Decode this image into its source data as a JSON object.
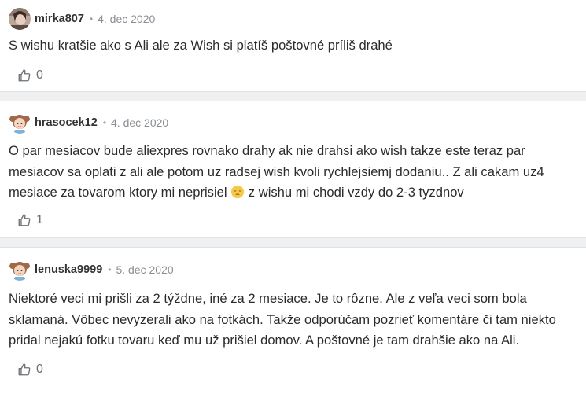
{
  "comments": [
    {
      "username": "mirka807",
      "separator": "•",
      "date": "4. dec 2020",
      "text": "S wishu kratšie ako s Ali ale za Wish si platíš poštovné príliš drahé",
      "likes": "0",
      "avatar": "photo-avatar"
    },
    {
      "username": "hrasocek12",
      "separator": "•",
      "date": "4. dec 2020",
      "text_before_emoji": "O par mesiacov bude aliexpres rovnako drahy ak nie drahsi ako wish takze este teraz par mesiacov sa oplati z ali ale potom uz radsej wish kvoli rychlejsiemj dodaniu.. Z ali cakam uz4 mesiace za tovarom ktory mi neprisiel ",
      "emoji": "pensive-face-emoji",
      "text_after_emoji": " z wishu mi chodi vzdy do 2-3 tyzdnov",
      "likes": "1",
      "avatar": "cartoon-girl-avatar"
    },
    {
      "username": "lenuska9999",
      "separator": "•",
      "date": "5. dec 2020",
      "text": "Niektoré veci mi prišli za 2 týždne, iné za 2 mesiace. Je to rôzne. Ale z veľa veci som bola sklamaná. Vôbec nevyzerali ako na fotkách. Takže odporúčam pozrieť komentáre či tam niekto pridal nejakú fotku tovaru keď mu už prišiel domov. A poštovné je tam drahšie ako na Ali.",
      "likes": "0",
      "avatar": "cartoon-girl-avatar"
    }
  ],
  "icons": {
    "like": "thumbs-up-outline-icon"
  },
  "colors": {
    "separator_bg": "#eef0f1",
    "text": "#2b2b2b",
    "meta": "#8a8f94"
  }
}
